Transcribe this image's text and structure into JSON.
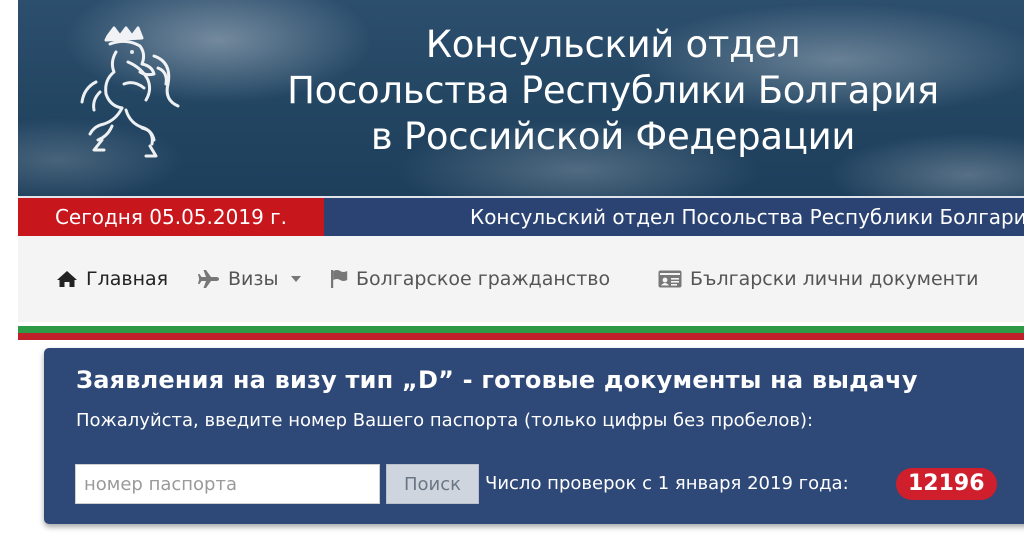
{
  "header": {
    "title_lines": [
      "Консульский отдел",
      "Посольства Республики Болгария",
      "в Российской Федерации"
    ]
  },
  "info_bar": {
    "date_text": "Сегодня 05.05.2019 г.",
    "ticker_text": "Консульский отдел Посольства Республики Болгария в Российской Федерации"
  },
  "nav": {
    "items": [
      {
        "label": "Главная",
        "icon": "home-icon"
      },
      {
        "label": "Визы",
        "icon": "plane-icon"
      },
      {
        "label": "Болгарское гражданство",
        "icon": "flag-icon"
      },
      {
        "label": "Български лични документи",
        "icon": "id-card-icon"
      }
    ]
  },
  "colors": {
    "flag_green": "#2f9a45",
    "flag_red": "#c0202a",
    "panel_bg": "#2e4877",
    "badge_red": "#d01f2c",
    "date_red": "#c8161d"
  },
  "panel": {
    "title": "Заявления на визу тип „D” - готовые документы на выдачу",
    "instruction": "Пожалуйста, введите номер Вашего паспорта (только цифры без пробелов):",
    "input_placeholder": "номер паспорта",
    "input_value": "",
    "search_label": "Поиск",
    "count_label": "Число проверок с 1 января 2019 года:",
    "count_value": "12196"
  }
}
